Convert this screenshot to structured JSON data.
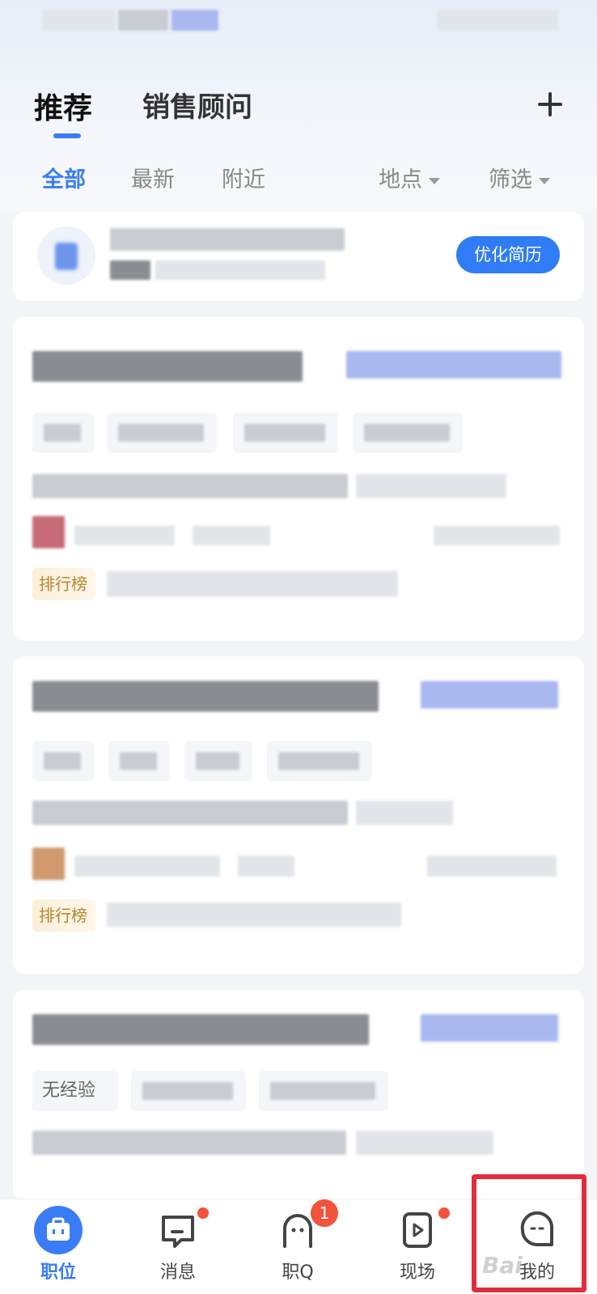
{
  "header": {
    "main_tabs": [
      {
        "label": "推荐",
        "active": true
      },
      {
        "label": "销售顾问",
        "active": false
      }
    ],
    "add_icon": "plus-icon"
  },
  "filters": {
    "tabs": [
      {
        "label": "全部",
        "active": true
      },
      {
        "label": "最新",
        "active": false
      },
      {
        "label": "附近",
        "active": false
      }
    ],
    "location_label": "地点",
    "filter_label": "筛选"
  },
  "resume_card": {
    "button_label": "优化简历"
  },
  "job_cards": {
    "rank_badge_1": "排行榜",
    "rank_badge_2": "排行榜",
    "tag_3_1": "无经验"
  },
  "bottom_nav": {
    "items": [
      {
        "label": "职位",
        "icon": "briefcase-icon",
        "active": true
      },
      {
        "label": "消息",
        "icon": "chat-icon",
        "dot": true
      },
      {
        "label": "职Q",
        "icon": "ghost-icon",
        "badge": "1"
      },
      {
        "label": "现场",
        "icon": "play-icon",
        "dot": true
      },
      {
        "label": "我的",
        "icon": "face-icon",
        "highlighted": true
      }
    ]
  },
  "colors": {
    "accent": "#3a7cf5",
    "badge_red": "#f2533a",
    "highlight_red": "#e22d3c"
  }
}
